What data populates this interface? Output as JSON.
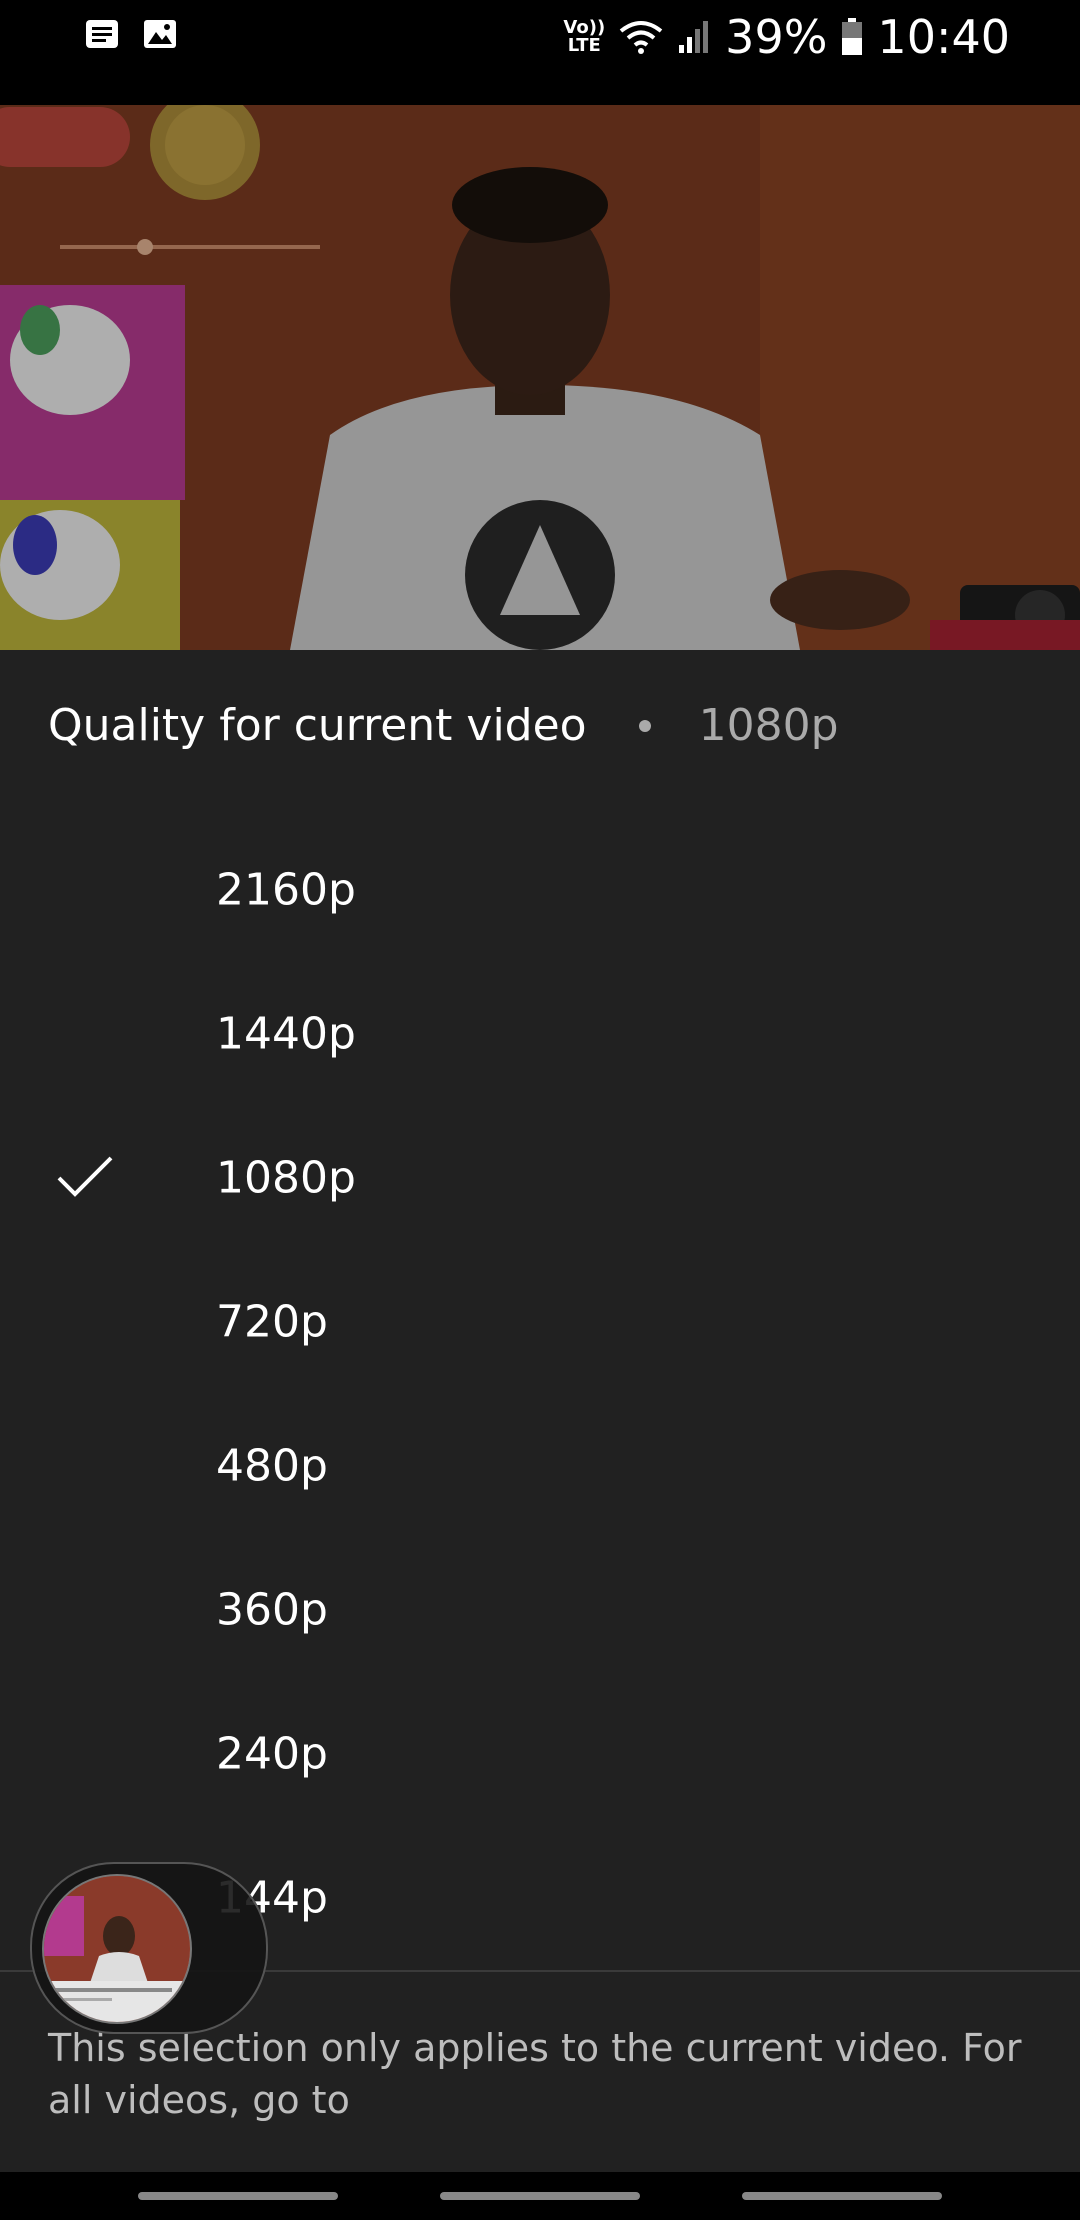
{
  "status_bar": {
    "left_icons": [
      "notification-icon",
      "image-icon"
    ],
    "network_label_top": "Vo))",
    "network_label_bottom": "LTE",
    "battery_percent": "39%",
    "time": "10:40"
  },
  "video": {
    "description_icon": "video-thumbnail"
  },
  "sheet": {
    "title": "Quality for current video",
    "current_quality": "1080p",
    "options": [
      {
        "label": "2160p",
        "selected": false
      },
      {
        "label": "1440p",
        "selected": false
      },
      {
        "label": "1080p",
        "selected": true
      },
      {
        "label": "720p",
        "selected": false
      },
      {
        "label": "480p",
        "selected": false
      },
      {
        "label": "360p",
        "selected": false
      },
      {
        "label": "240p",
        "selected": false
      },
      {
        "label": "144p",
        "selected": false
      }
    ],
    "footer_note": "This selection only applies to the current video. For all videos, go to"
  },
  "colors": {
    "sheet_bg": "#212121",
    "secondary_text": "#aaaaaa"
  }
}
